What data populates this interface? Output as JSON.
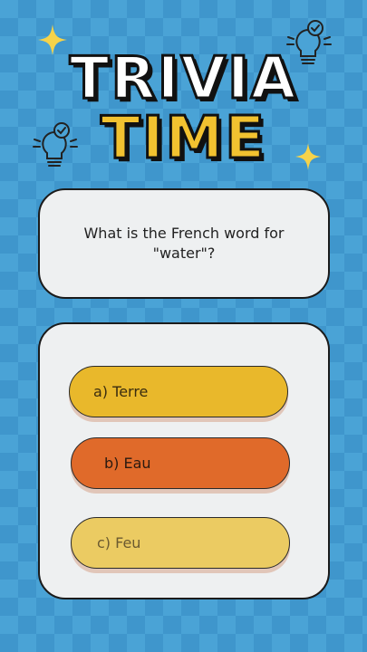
{
  "title": {
    "line1": "TRIVIA",
    "line2": "TIME"
  },
  "question": "What is the French word for \"water\"?",
  "options": [
    {
      "label": "a) Terre"
    },
    {
      "label": "b) Eau"
    },
    {
      "label": "c) Feu"
    }
  ],
  "colors": {
    "background": "#4aa3d6",
    "card": "#eef0f1",
    "title_accent": "#f2c230",
    "option_a": "#e9b82b",
    "option_b": "#e06a2a",
    "option_c": "#ebcb62",
    "star": "#f6d34a"
  },
  "icons": [
    "sparkle-star-icon",
    "lightbulb-check-icon"
  ]
}
